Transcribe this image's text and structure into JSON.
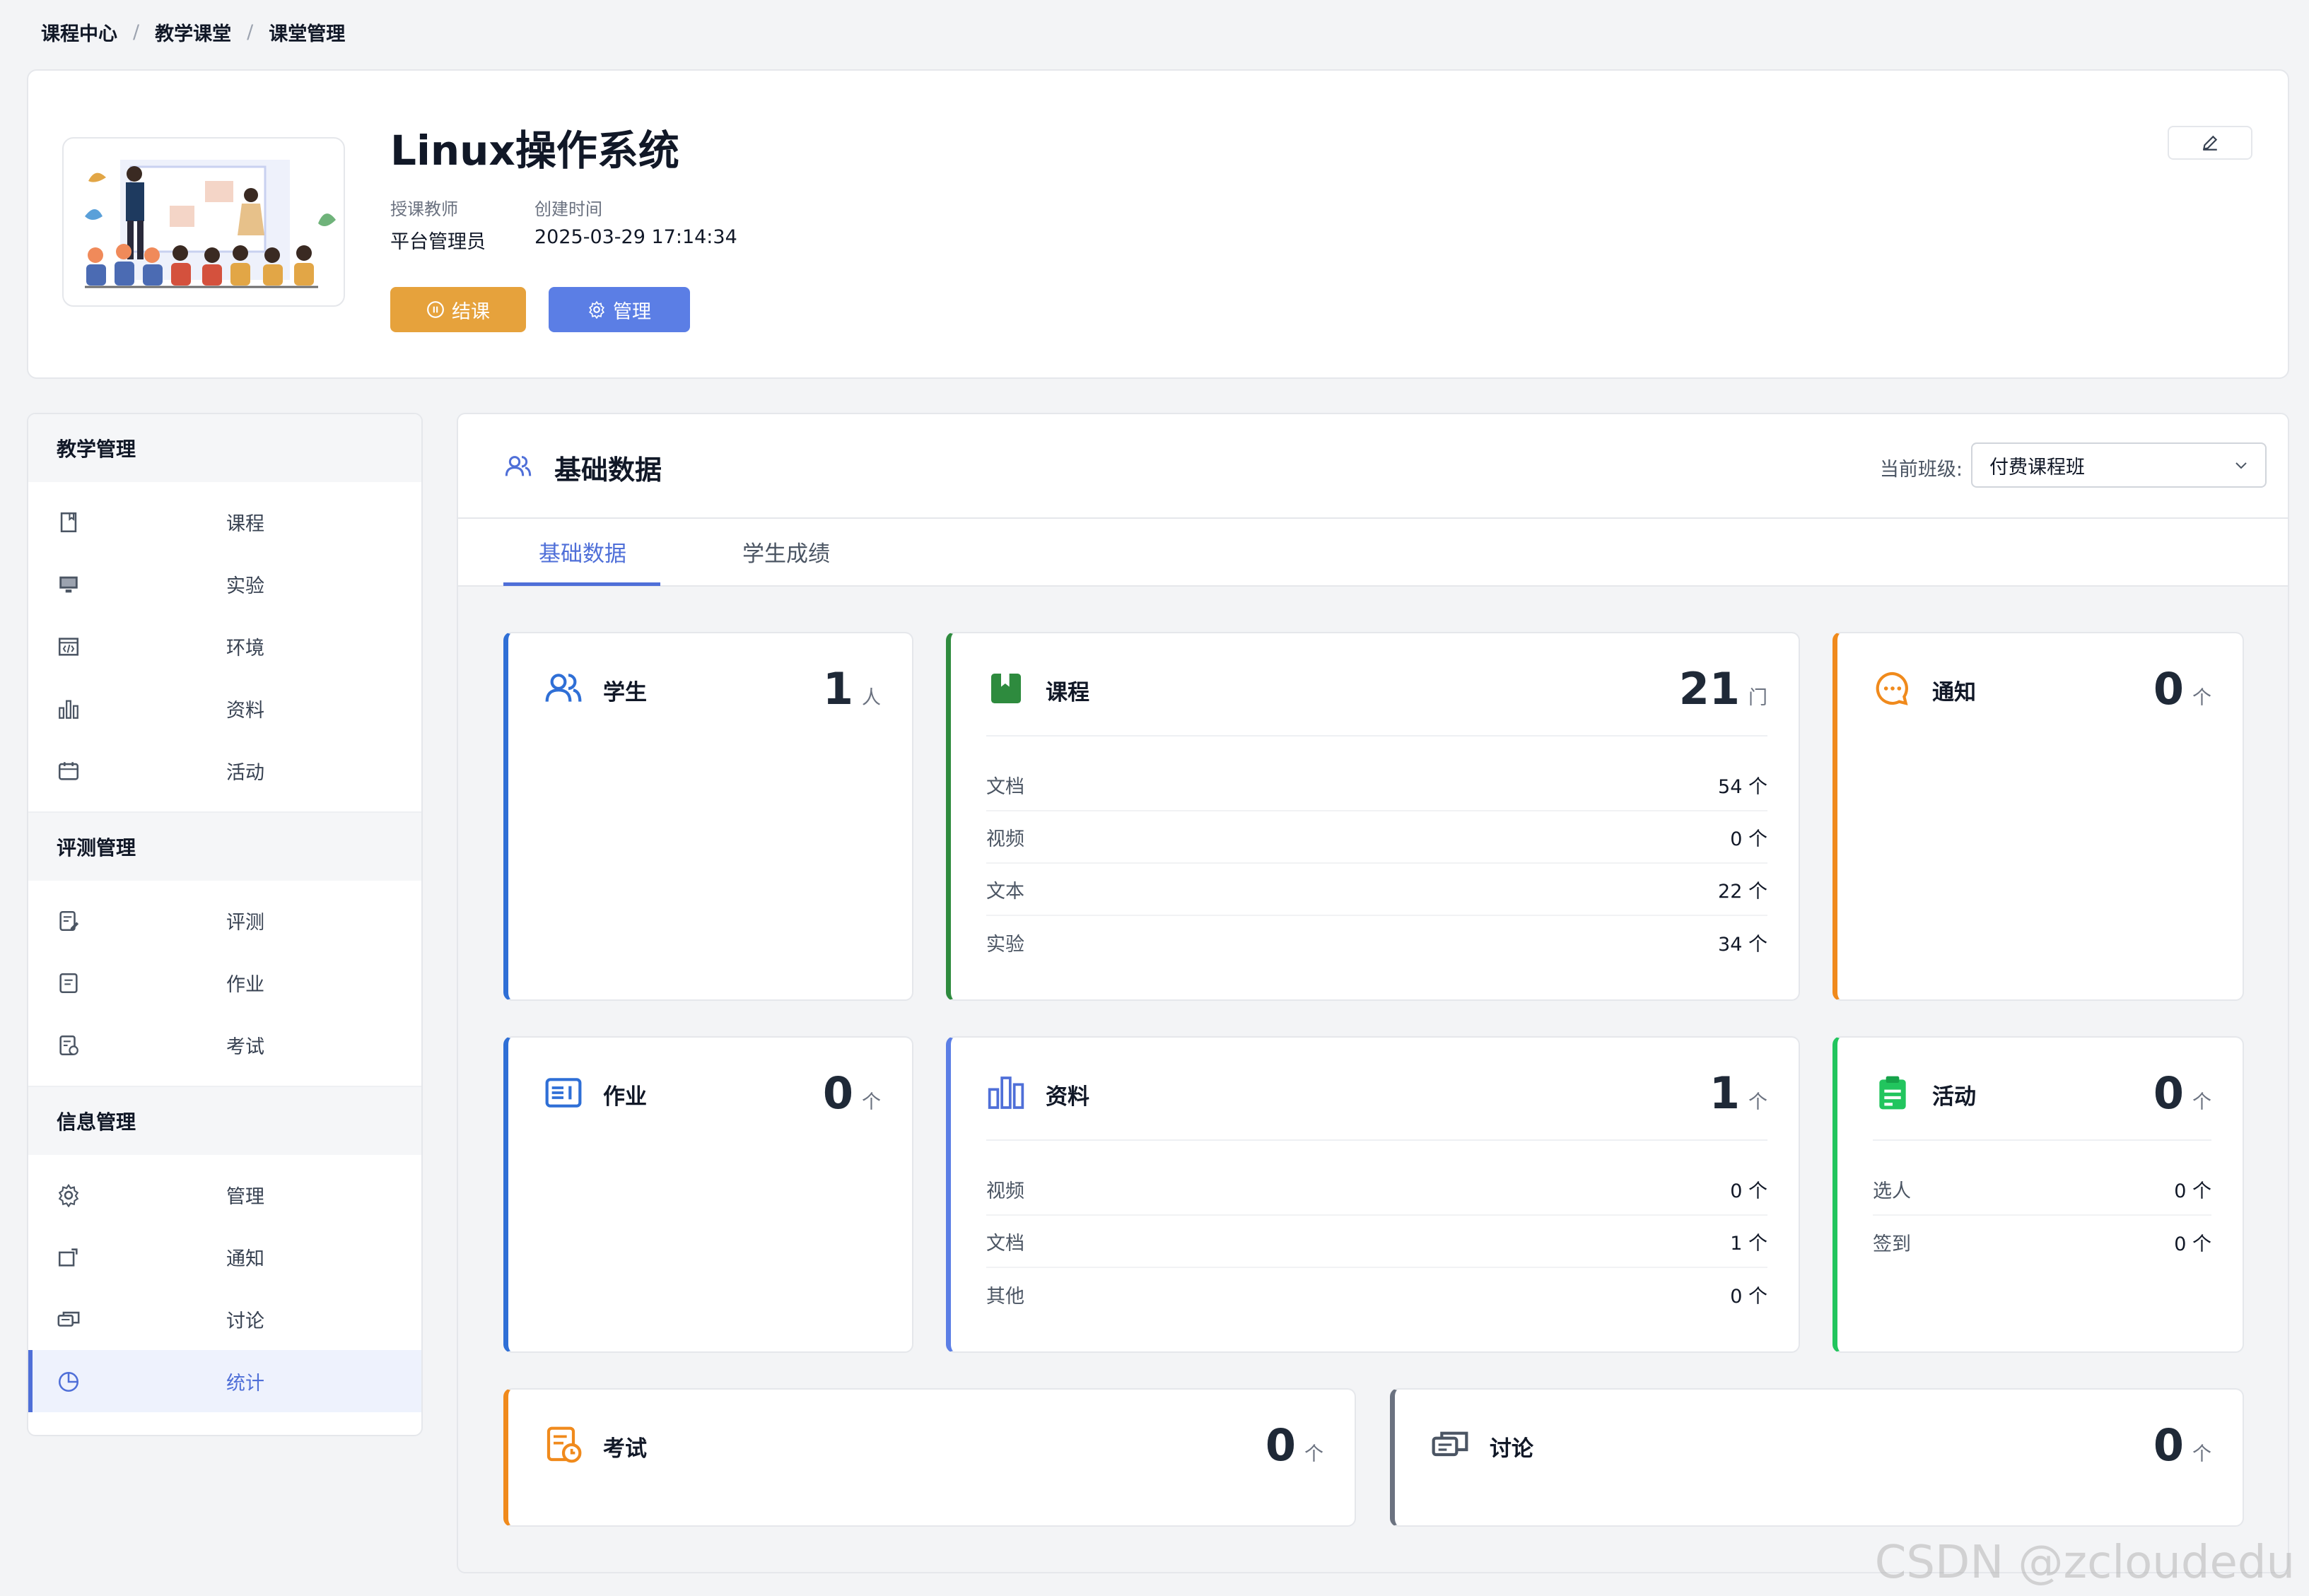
{
  "breadcrumb": [
    "课程中心",
    "教学课堂",
    "课堂管理"
  ],
  "header": {
    "title": "Linux操作系统",
    "teacher_label": "授课教师",
    "teacher_value": "平台管理员",
    "created_label": "创建时间",
    "created_value": "2025-03-29 17:14:34",
    "end_button": "结课",
    "manage_button": "管理"
  },
  "sidebar": {
    "groups": [
      {
        "title": "教学管理",
        "items": [
          {
            "label": "课程",
            "icon": "book-icon"
          },
          {
            "label": "实验",
            "icon": "monitor-icon"
          },
          {
            "label": "环境",
            "icon": "code-window-icon"
          },
          {
            "label": "资料",
            "icon": "bar-chart-icon"
          },
          {
            "label": "活动",
            "icon": "calendar-icon"
          }
        ]
      },
      {
        "title": "评测管理",
        "items": [
          {
            "label": "评测",
            "icon": "edit-document-icon"
          },
          {
            "label": "作业",
            "icon": "document-icon"
          },
          {
            "label": "考试",
            "icon": "exam-icon"
          }
        ]
      },
      {
        "title": "信息管理",
        "items": [
          {
            "label": "管理",
            "icon": "gear-icon"
          },
          {
            "label": "通知",
            "icon": "notice-icon"
          },
          {
            "label": "讨论",
            "icon": "chat-icon"
          },
          {
            "label": "统计",
            "icon": "pie-chart-icon"
          }
        ]
      }
    ]
  },
  "panel": {
    "title": "基础数据",
    "class_label": "当前班级:",
    "class_value": "付费课程班",
    "tabs": [
      "基础数据",
      "学生成绩"
    ]
  },
  "cards": {
    "student": {
      "title": "学生",
      "value": "1",
      "unit": "人"
    },
    "course": {
      "title": "课程",
      "value": "21",
      "unit": "门",
      "rows": [
        {
          "label": "文档",
          "value": "54 个"
        },
        {
          "label": "视频",
          "value": "0 个"
        },
        {
          "label": "文本",
          "value": "22 个"
        },
        {
          "label": "实验",
          "value": "34 个"
        }
      ]
    },
    "notice": {
      "title": "通知",
      "value": "0",
      "unit": "个"
    },
    "homework": {
      "title": "作业",
      "value": "0",
      "unit": "个"
    },
    "material": {
      "title": "资料",
      "value": "1",
      "unit": "个",
      "rows": [
        {
          "label": "视频",
          "value": "0 个"
        },
        {
          "label": "文档",
          "value": "1 个"
        },
        {
          "label": "其他",
          "value": "0 个"
        }
      ]
    },
    "activity": {
      "title": "活动",
      "value": "0",
      "unit": "个",
      "rows": [
        {
          "label": "选人",
          "value": "0 个"
        },
        {
          "label": "签到",
          "value": "0 个"
        }
      ]
    },
    "exam": {
      "title": "考试",
      "value": "0",
      "unit": "个"
    },
    "discussion": {
      "title": "讨论",
      "value": "0",
      "unit": "个"
    }
  },
  "colors": {
    "blue": "#2f6fd6",
    "green": "#2e8b3e",
    "orange": "#f08a1c",
    "bright_green": "#22c55e",
    "gray": "#6b7280",
    "primary": "#5b7ee5",
    "warning": "#e6a23c"
  },
  "watermark": "CSDN @zcloudedu"
}
